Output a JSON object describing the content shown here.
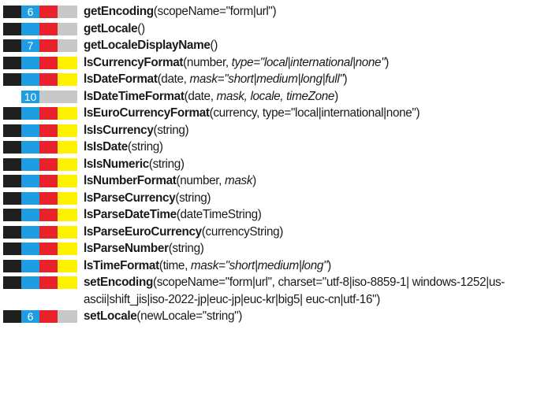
{
  "colors": {
    "black": "#1f1f1f",
    "blue": "#1e9de2",
    "red": "#e8212b",
    "yellow": "#fff200",
    "gray": "#c8c8c8",
    "white": "#ffffff",
    "number_on_blue": "#ffffff"
  },
  "functions": [
    {
      "bar": [
        "black",
        "blue",
        "red",
        "gray"
      ],
      "badge": "6",
      "badge_seg": 1,
      "name": "getEncoding",
      "params": [
        {
          "t": "(scopeName=\"form|url\")",
          "i": false
        }
      ]
    },
    {
      "bar": [
        "black",
        "blue",
        "red",
        "gray"
      ],
      "badge": "",
      "badge_seg": -1,
      "name": "getLocale",
      "params": [
        {
          "t": "()",
          "i": false
        }
      ]
    },
    {
      "bar": [
        "black",
        "blue",
        "red",
        "gray"
      ],
      "badge": "7",
      "badge_seg": 1,
      "name": "getLocaleDisplayName",
      "params": [
        {
          "t": "()",
          "i": false
        }
      ]
    },
    {
      "bar": [
        "black",
        "blue",
        "red",
        "yellow"
      ],
      "badge": "",
      "badge_seg": -1,
      "name": "lsCurrencyFormat",
      "params": [
        {
          "t": "(number, ",
          "i": false
        },
        {
          "t": "type=\"local|international|none\"",
          "i": true
        },
        {
          "t": ")",
          "i": false
        }
      ]
    },
    {
      "bar": [
        "black",
        "blue",
        "red",
        "yellow"
      ],
      "badge": "",
      "badge_seg": -1,
      "name": "lsDateFormat",
      "params": [
        {
          "t": "(date, ",
          "i": false
        },
        {
          "t": "mask=\"short|medium|long|full\"",
          "i": true
        },
        {
          "t": ")",
          "i": false
        }
      ]
    },
    {
      "bar": [
        "white",
        "blue",
        "gray",
        "gray"
      ],
      "badge": "10",
      "badge_seg": 1,
      "name": "lsDateTimeFormat",
      "params": [
        {
          "t": "(date, ",
          "i": false
        },
        {
          "t": "mask, locale, timeZone",
          "i": true
        },
        {
          "t": ")",
          "i": false
        }
      ]
    },
    {
      "bar": [
        "black",
        "blue",
        "red",
        "yellow"
      ],
      "badge": "",
      "badge_seg": -1,
      "name": "lsEuroCurrencyFormat",
      "params": [
        {
          "t": "(currency, type=\"local|international|none\")",
          "i": false
        }
      ]
    },
    {
      "bar": [
        "black",
        "blue",
        "red",
        "yellow"
      ],
      "badge": "",
      "badge_seg": -1,
      "name": "lsIsCurrency",
      "params": [
        {
          "t": "(string)",
          "i": false
        }
      ]
    },
    {
      "bar": [
        "black",
        "blue",
        "red",
        "yellow"
      ],
      "badge": "",
      "badge_seg": -1,
      "name": "lsIsDate",
      "params": [
        {
          "t": "(string)",
          "i": false
        }
      ]
    },
    {
      "bar": [
        "black",
        "blue",
        "red",
        "yellow"
      ],
      "badge": "",
      "badge_seg": -1,
      "name": "lsIsNumeric",
      "params": [
        {
          "t": "(string)",
          "i": false
        }
      ]
    },
    {
      "bar": [
        "black",
        "blue",
        "red",
        "yellow"
      ],
      "badge": "",
      "badge_seg": -1,
      "name": "lsNumberFormat",
      "params": [
        {
          "t": "(number, ",
          "i": false
        },
        {
          "t": "mask",
          "i": true
        },
        {
          "t": ")",
          "i": false
        }
      ]
    },
    {
      "bar": [
        "black",
        "blue",
        "red",
        "yellow"
      ],
      "badge": "",
      "badge_seg": -1,
      "name": "lsParseCurrency",
      "params": [
        {
          "t": "(string)",
          "i": false
        }
      ]
    },
    {
      "bar": [
        "black",
        "blue",
        "red",
        "yellow"
      ],
      "badge": "",
      "badge_seg": -1,
      "name": "lsParseDateTime",
      "params": [
        {
          "t": "(dateTimeString)",
          "i": false
        }
      ]
    },
    {
      "bar": [
        "black",
        "blue",
        "red",
        "yellow"
      ],
      "badge": "",
      "badge_seg": -1,
      "name": "lsParseEuroCurrency",
      "params": [
        {
          "t": "(currencyString)",
          "i": false
        }
      ]
    },
    {
      "bar": [
        "black",
        "blue",
        "red",
        "yellow"
      ],
      "badge": "",
      "badge_seg": -1,
      "name": "lsParseNumber",
      "params": [
        {
          "t": "(string)",
          "i": false
        }
      ]
    },
    {
      "bar": [
        "black",
        "blue",
        "red",
        "yellow"
      ],
      "badge": "",
      "badge_seg": -1,
      "name": "lsTimeFormat",
      "params": [
        {
          "t": "(time, ",
          "i": false
        },
        {
          "t": "mask=\"short|medium|long\"",
          "i": true
        },
        {
          "t": ")",
          "i": false
        }
      ]
    },
    {
      "bar": [
        "black",
        "blue",
        "red",
        "yellow"
      ],
      "badge": "",
      "badge_seg": -1,
      "name": "setEncoding",
      "params": [
        {
          "t": "(scopeName=\"form|url\", charset=\"utf-8|iso-8859-1| windows-1252|us-ascii|shift_jis|iso-2022-jp|euc-jp|euc-kr|big5| euc-cn|utf-16\")",
          "i": false
        }
      ]
    },
    {
      "bar": [
        "black",
        "blue",
        "red",
        "gray"
      ],
      "badge": "6",
      "badge_seg": 1,
      "name": "setLocale",
      "params": [
        {
          "t": "(newLocale=\"string\")",
          "i": false
        }
      ]
    }
  ]
}
